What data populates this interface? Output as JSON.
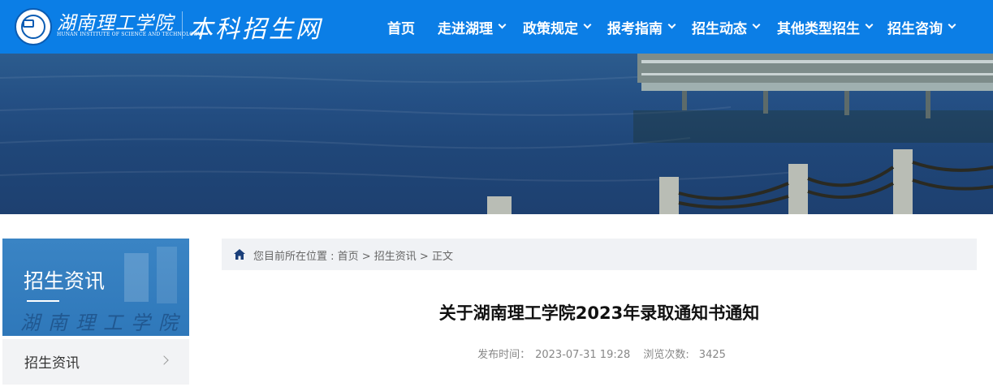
{
  "header": {
    "logo_cn": "湖南理工学院",
    "logo_en": "HUNAN INSTITUTE OF SCIENCE AND TECHNOLOGY",
    "site_name": "本科招生网",
    "brand_color": "#0b7ee6"
  },
  "nav": {
    "items": [
      {
        "label": "首页",
        "has_dropdown": false
      },
      {
        "label": "走进湖理",
        "has_dropdown": true
      },
      {
        "label": "政策规定",
        "has_dropdown": true
      },
      {
        "label": "报考指南",
        "has_dropdown": true
      },
      {
        "label": "招生动态",
        "has_dropdown": true
      },
      {
        "label": "其他类型招生",
        "has_dropdown": true
      },
      {
        "label": "招生咨询",
        "has_dropdown": true
      }
    ]
  },
  "sidebar": {
    "title": "招生资讯",
    "watermark": "湖南理工学院",
    "items": [
      {
        "label": "招生资讯",
        "icon": "chevron-right-icon"
      }
    ]
  },
  "breadcrumb": {
    "icon": "home-icon",
    "text": "您目前所在位置 : 首页 > 招生资讯 > 正文"
  },
  "article": {
    "title": "关于湖南理工学院2023年录取通知书通知",
    "publish_label": "发布时间：",
    "publish_time": "2023-07-31 19:28",
    "views_label": "浏览次数:",
    "views": "3425"
  }
}
